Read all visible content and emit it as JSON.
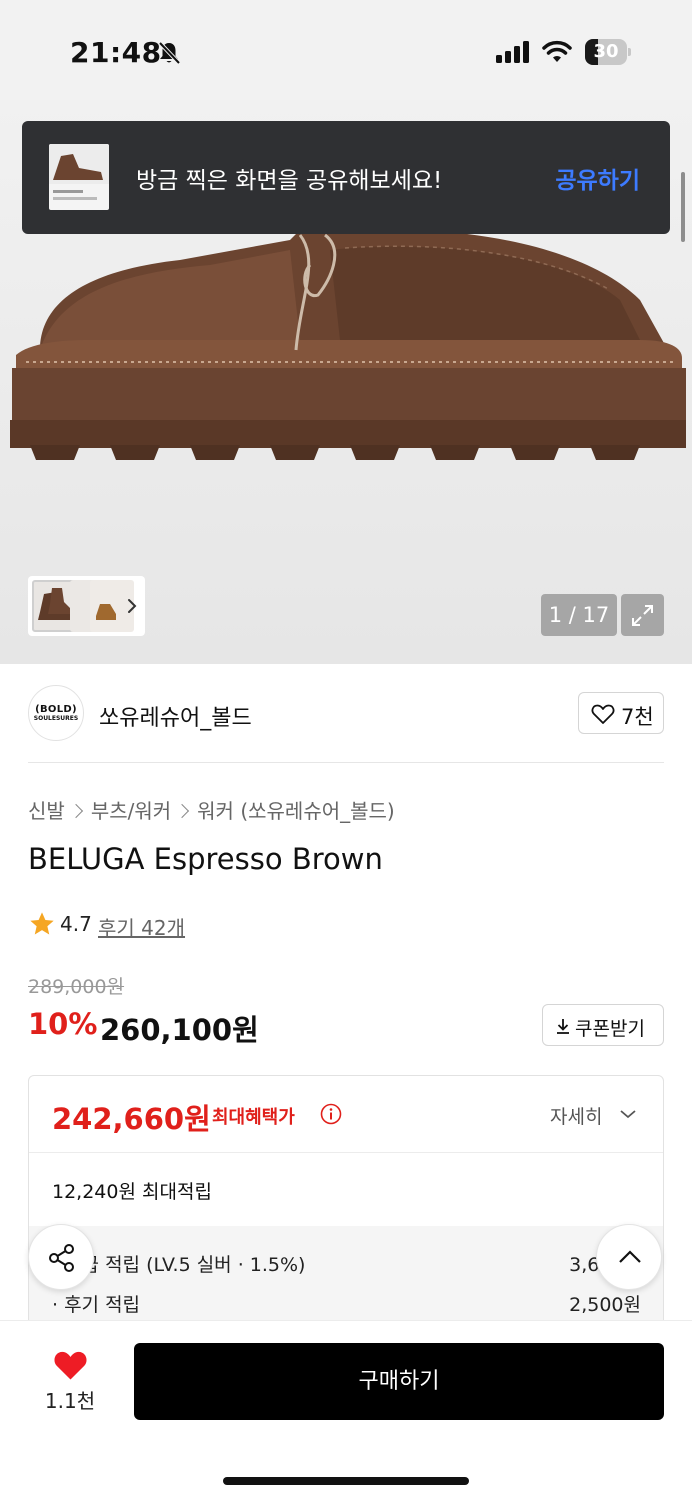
{
  "status_bar": {
    "time": "21:48",
    "battery": "30",
    "battery_level": 0.3
  },
  "toast": {
    "message": "방금 찍은 화면을 공유해보세요!",
    "action": "공유하기"
  },
  "gallery": {
    "counter": "1 / 17"
  },
  "brand": {
    "logo_main": "(BOLD)",
    "logo_sub": "SOULESURES",
    "name": "쏘유레슈어_볼드",
    "likes": "7천"
  },
  "breadcrumb": [
    "신발",
    "부츠/워커",
    "워커 (쏘유레슈어_볼드)"
  ],
  "product": {
    "title": "BELUGA Espresso Brown",
    "rating": "4.7",
    "reviews": "후기 42개",
    "original_price": "289,000원",
    "discount": "10%",
    "price": "260,100원",
    "coupon": "쿠폰받기"
  },
  "benefit": {
    "best_price": "242,660원",
    "best_label": "최대혜택가",
    "detail": "자세히",
    "max_points": "12,240원 최대적립",
    "points": [
      {
        "label": "· 등급 적립 (LV.5 실버 · 1.5%)",
        "amount": "3,630원"
      },
      {
        "label": "· 후기 적립",
        "amount": "2,500원"
      }
    ]
  },
  "bottom_bar": {
    "wish_count": "1.1천",
    "buy": "구매하기"
  },
  "colors": {
    "accent_red": "#e0201b",
    "toast_action": "#3d7bff",
    "star": "#f5a623"
  },
  "icons": [
    "bell-slash-icon",
    "signal-icon",
    "wifi-icon",
    "battery-icon",
    "chevron-right-icon",
    "expand-icon",
    "heart-outline-icon",
    "star-icon",
    "download-icon",
    "info-icon",
    "chevron-down-icon",
    "share-icon",
    "chevron-up-icon",
    "heart-filled-icon"
  ]
}
